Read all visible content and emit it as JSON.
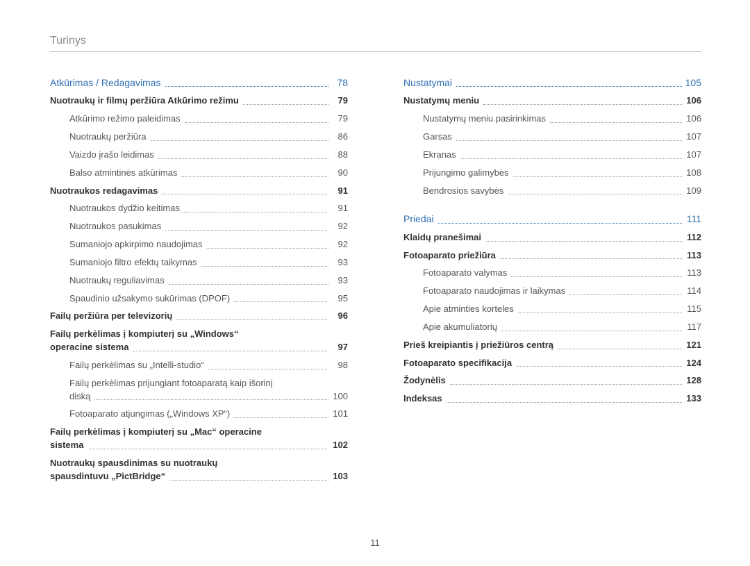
{
  "pageTitle": "Turinys",
  "pageNumber": "11",
  "left": {
    "section1": {
      "label": "Atkūrimas / Redagavimas",
      "page": "78"
    },
    "b1": {
      "label": "Nuotraukų ir filmų peržiūra Atkūrimo režimu",
      "page": "79"
    },
    "s1": {
      "label": "Atkūrimo režimo paleidimas",
      "page": "79"
    },
    "s2": {
      "label": "Nuotraukų peržiūra",
      "page": "86"
    },
    "s3": {
      "label": "Vaizdo įrašo leidimas",
      "page": "88"
    },
    "s4": {
      "label": "Balso atmintinės atkūrimas",
      "page": "90"
    },
    "b2": {
      "label": "Nuotraukos redagavimas",
      "page": "91"
    },
    "s5": {
      "label": "Nuotraukos dydžio keitimas",
      "page": "91"
    },
    "s6": {
      "label": "Nuotraukos pasukimas",
      "page": "92"
    },
    "s7": {
      "label": "Sumaniojo apkirpimo naudojimas",
      "page": "92"
    },
    "s8": {
      "label": "Sumaniojo filtro efektų taikymas",
      "page": "93"
    },
    "s9": {
      "label": "Nuotraukų reguliavimas",
      "page": "93"
    },
    "s10": {
      "label": "Spaudinio užsakymo sukūrimas (DPOF)",
      "page": "95"
    },
    "b3": {
      "label": "Failų peržiūra per televizorių",
      "page": "96"
    },
    "b4a": {
      "label": "Failų perkėlimas į kompiuterį su „Windows“"
    },
    "b4b": {
      "label": "operacine sistema",
      "page": "97"
    },
    "s11": {
      "label": "Failų perkėlimas su „Intelli-studio“",
      "page": "98"
    },
    "s12a": {
      "label": "Failų perkėlimas prijungiant fotoaparatą kaip išorinį"
    },
    "s12b": {
      "label": "diską",
      "page": "100"
    },
    "s13": {
      "label": "Fotoaparato atjungimas („Windows XP“)",
      "page": "101"
    },
    "b5a": {
      "label": "Failų perkėlimas į kompiuterį su „Mac“ operacine"
    },
    "b5b": {
      "label": "sistema",
      "page": "102"
    },
    "b6a": {
      "label": "Nuotraukų spausdinimas su nuotraukų"
    },
    "b6b": {
      "label": "spausdintuvu „PictBridge“",
      "page": "103"
    }
  },
  "right": {
    "section1": {
      "label": "Nustatymai",
      "page": "105"
    },
    "b1": {
      "label": "Nustatymų meniu",
      "page": "106"
    },
    "s1": {
      "label": "Nustatymų meniu pasirinkimas",
      "page": "106"
    },
    "s2": {
      "label": "Garsas",
      "page": "107"
    },
    "s3": {
      "label": "Ekranas",
      "page": "107"
    },
    "s4": {
      "label": "Prijungimo galimybės",
      "page": "108"
    },
    "s5": {
      "label": "Bendrosios savybės",
      "page": "109"
    },
    "section2": {
      "label": "Priedai",
      "page": "111"
    },
    "b2": {
      "label": "Klaidų pranešimai",
      "page": "112"
    },
    "b3": {
      "label": "Fotoaparato priežiūra",
      "page": "113"
    },
    "s6": {
      "label": "Fotoaparato valymas",
      "page": "113"
    },
    "s7": {
      "label": "Fotoaparato naudojimas ir laikymas",
      "page": "114"
    },
    "s8": {
      "label": "Apie atminties korteles",
      "page": "115"
    },
    "s9": {
      "label": "Apie akumuliatorių",
      "page": "117"
    },
    "b4": {
      "label": "Prieš kreipiantis į priežiūros centrą",
      "page": "121"
    },
    "b5": {
      "label": "Fotoaparato specifikacija",
      "page": "124"
    },
    "b6": {
      "label": "Žodynėlis",
      "page": "128"
    },
    "b7": {
      "label": "Indeksas",
      "page": "133"
    }
  }
}
